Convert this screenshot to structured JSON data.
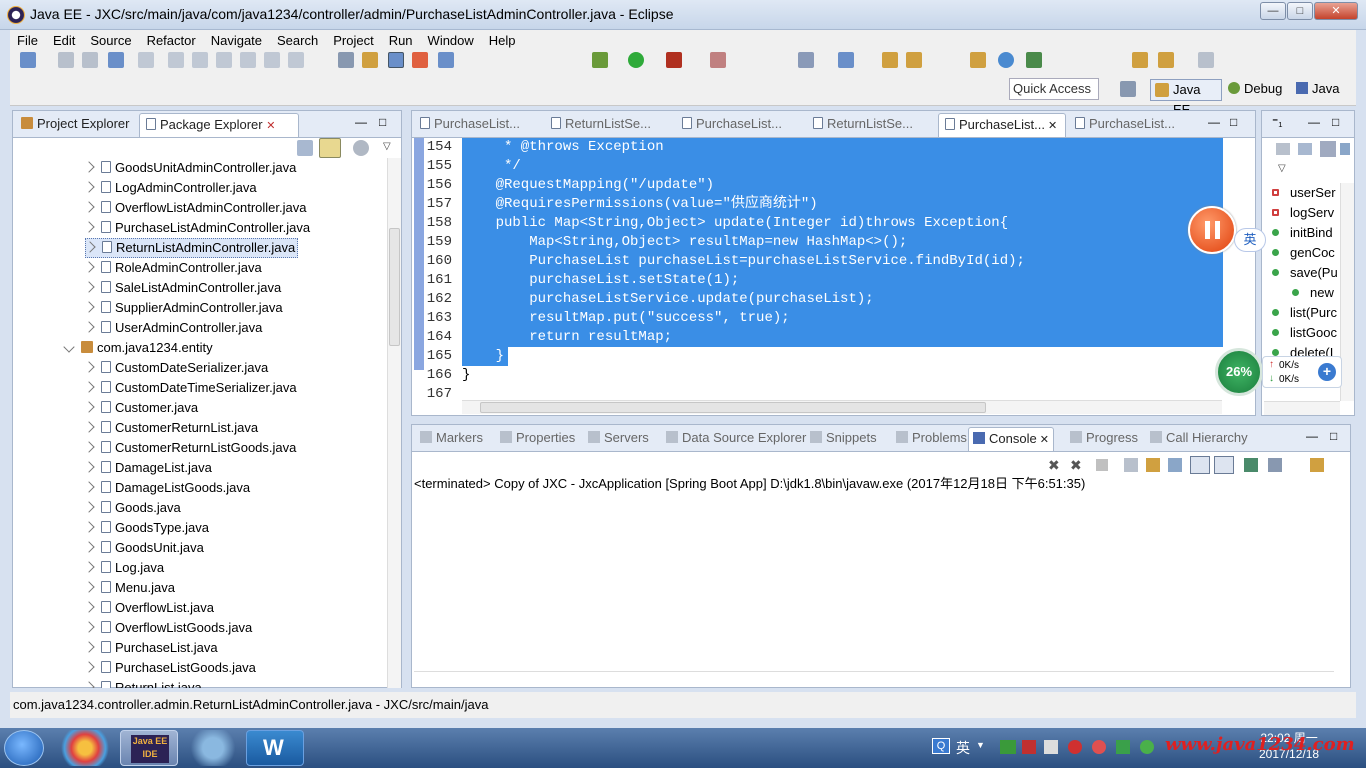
{
  "window": {
    "title": "Java EE - JXC/src/main/java/com/java1234/controller/admin/PurchaseListAdminController.java - Eclipse",
    "minimize": "—",
    "maximize": "□",
    "close": "✕"
  },
  "menu": [
    "File",
    "Edit",
    "Source",
    "Refactor",
    "Navigate",
    "Search",
    "Project",
    "Run",
    "Window",
    "Help"
  ],
  "toolbar": {
    "quick_access": "Quick Access",
    "perspectives": [
      "Java EE",
      "Debug",
      "Java"
    ]
  },
  "explorer": {
    "tabs": [
      {
        "label": "Project Explorer"
      },
      {
        "label": "Package Explorer"
      }
    ],
    "items": [
      {
        "label": "GoodsUnitAdminController.java",
        "kind": "file"
      },
      {
        "label": "LogAdminController.java",
        "kind": "file"
      },
      {
        "label": "OverflowListAdminController.java",
        "kind": "file"
      },
      {
        "label": "PurchaseListAdminController.java",
        "kind": "file"
      },
      {
        "label": "ReturnListAdminController.java",
        "kind": "file",
        "selected": true
      },
      {
        "label": "RoleAdminController.java",
        "kind": "file"
      },
      {
        "label": "SaleListAdminController.java",
        "kind": "file"
      },
      {
        "label": "SupplierAdminController.java",
        "kind": "file"
      },
      {
        "label": "UserAdminController.java",
        "kind": "file"
      },
      {
        "label": "com.java1234.entity",
        "kind": "package"
      },
      {
        "label": "CustomDateSerializer.java",
        "kind": "file"
      },
      {
        "label": "CustomDateTimeSerializer.java",
        "kind": "file"
      },
      {
        "label": "Customer.java",
        "kind": "file"
      },
      {
        "label": "CustomerReturnList.java",
        "kind": "file"
      },
      {
        "label": "CustomerReturnListGoods.java",
        "kind": "file"
      },
      {
        "label": "DamageList.java",
        "kind": "file"
      },
      {
        "label": "DamageListGoods.java",
        "kind": "file"
      },
      {
        "label": "Goods.java",
        "kind": "file"
      },
      {
        "label": "GoodsType.java",
        "kind": "file"
      },
      {
        "label": "GoodsUnit.java",
        "kind": "file"
      },
      {
        "label": "Log.java",
        "kind": "file"
      },
      {
        "label": "Menu.java",
        "kind": "file"
      },
      {
        "label": "OverflowList.java",
        "kind": "file"
      },
      {
        "label": "OverflowListGoods.java",
        "kind": "file"
      },
      {
        "label": "PurchaseList.java",
        "kind": "file"
      },
      {
        "label": "PurchaseListGoods.java",
        "kind": "file"
      },
      {
        "label": "ReturnList.java",
        "kind": "file"
      }
    ]
  },
  "editor": {
    "tabs": [
      "PurchaseList...",
      "ReturnListSe...",
      "PurchaseList...",
      "ReturnListSe...",
      "PurchaseList...",
      "PurchaseList..."
    ],
    "active_tab": 4,
    "lines": [
      {
        "n": "154",
        "code": "     * @throws Exception"
      },
      {
        "n": "155",
        "code": "     */"
      },
      {
        "n": "156",
        "code": "    @RequestMapping(\"/update\")"
      },
      {
        "n": "157",
        "code": "    @RequiresPermissions(value=\"供应商统计\")"
      },
      {
        "n": "158",
        "code": "    public Map<String,Object> update(Integer id)throws Exception{"
      },
      {
        "n": "159",
        "code": "        Map<String,Object> resultMap=new HashMap<>();"
      },
      {
        "n": "160",
        "code": "        PurchaseList purchaseList=purchaseListService.findById(id);"
      },
      {
        "n": "161",
        "code": "        purchaseList.setState(1);"
      },
      {
        "n": "162",
        "code": "        purchaseListService.update(purchaseList);"
      },
      {
        "n": "163",
        "code": "        resultMap.put(\"success\", true);"
      },
      {
        "n": "164",
        "code": "        return resultMap;"
      },
      {
        "n": "165",
        "code": "    }"
      },
      {
        "n": "166",
        "code": "}"
      },
      {
        "n": "167",
        "code": ""
      }
    ]
  },
  "bottom": {
    "tabs": [
      "Markers",
      "Properties",
      "Servers",
      "Data Source Explorer",
      "Snippets",
      "Problems",
      "Console",
      "Progress",
      "Call Hierarchy"
    ],
    "active_tab": "Console",
    "console_text": "<terminated> Copy of JXC - JxcApplication [Spring Boot App] D:\\jdk1.8\\bin\\javaw.exe (2017年12月18日 下午6:51:35)"
  },
  "outline": {
    "items": [
      {
        "label": "userSer",
        "color": "#d04040"
      },
      {
        "label": "logServ",
        "color": "#d04040"
      },
      {
        "label": "initBind",
        "color": "#3aa44a"
      },
      {
        "label": "genCoc",
        "color": "#3aa44a"
      },
      {
        "label": "save(Pu",
        "color": "#3aa44a"
      },
      {
        "label": "new",
        "color": "#3aa44a"
      },
      {
        "label": "list(Purc",
        "color": "#3aa44a"
      },
      {
        "label": "listGooc",
        "color": "#3aa44a"
      },
      {
        "label": "delete(I",
        "color": "#3aa44a"
      }
    ]
  },
  "overlays": {
    "ime": "英",
    "progress_percent": "26%",
    "net_up": "0K/s",
    "net_down": "0K/s"
  },
  "status": {
    "text": "com.java1234.controller.admin.ReturnListAdminController.java - JXC/src/main/java"
  },
  "taskbar": {
    "ime": "英",
    "time": "22:02 周一",
    "date": "2017/12/18",
    "watermark": "www.java1234.com",
    "eclipse_label": "Java EE IDE"
  }
}
